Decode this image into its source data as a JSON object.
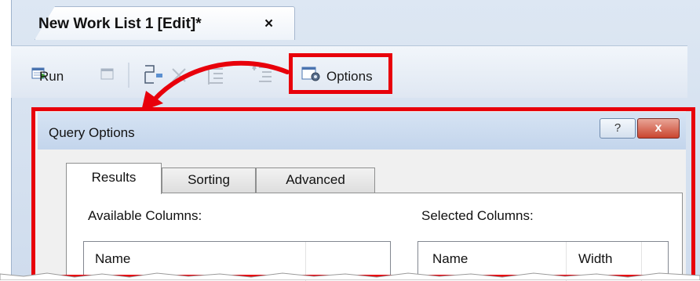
{
  "document_tab": {
    "title": "New Work List 1 [Edit]*",
    "close_glyph": "×"
  },
  "toolbar": {
    "run_label": "Run",
    "options_label": "Options"
  },
  "dialog": {
    "title": "Query Options",
    "help_glyph": "?",
    "close_glyph": "x",
    "tabs": [
      {
        "label": "Results",
        "selected": true
      },
      {
        "label": "Sorting",
        "selected": false
      },
      {
        "label": "Advanced",
        "selected": false
      }
    ],
    "available_columns": {
      "label": "Available Columns:",
      "headers": [
        "Name"
      ]
    },
    "selected_columns": {
      "label": "Selected Columns:",
      "headers": [
        "Name",
        "Width"
      ]
    }
  },
  "colors": {
    "highlight": "#e8000b",
    "chrome": "#d3dfee",
    "dialog_bg": "#f0f0f0"
  }
}
